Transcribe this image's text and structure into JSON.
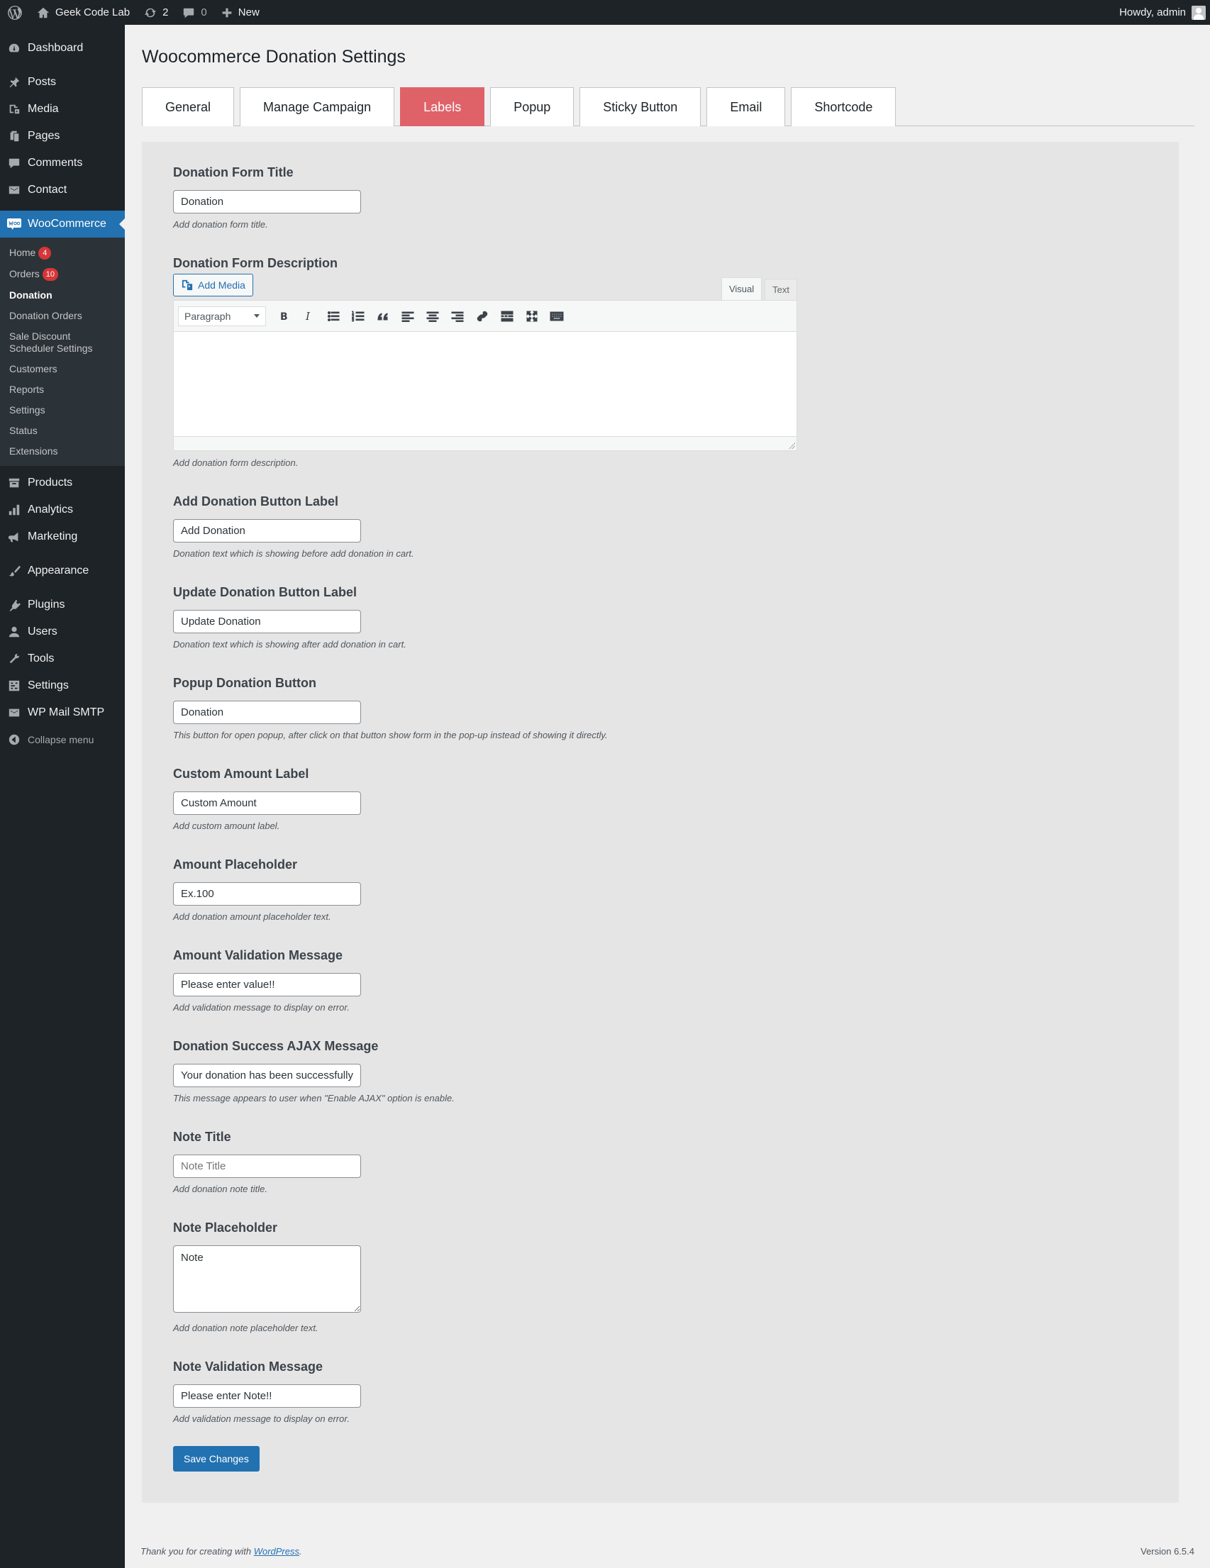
{
  "admin_bar": {
    "site_name": "Geek Code Lab",
    "updates_count": "2",
    "comments_count": "0",
    "new_label": "New",
    "howdy": "Howdy, admin"
  },
  "sidebar": {
    "top_items": [
      {
        "label": "Dashboard",
        "icon": "dashboard-icon"
      },
      {
        "label": "Posts",
        "icon": "pin-icon"
      },
      {
        "label": "Media",
        "icon": "media-icon"
      },
      {
        "label": "Pages",
        "icon": "pages-icon"
      },
      {
        "label": "Comments",
        "icon": "comment-icon"
      },
      {
        "label": "Contact",
        "icon": "mail-icon"
      }
    ],
    "woocommerce_label": "WooCommerce",
    "woo_submenu": [
      {
        "label": "Home",
        "badge": "4"
      },
      {
        "label": "Orders",
        "badge": "10"
      },
      {
        "label": "Donation"
      },
      {
        "label": "Donation Orders"
      },
      {
        "label": "Sale Discount Scheduler Settings"
      },
      {
        "label": "Customers"
      },
      {
        "label": "Reports"
      },
      {
        "label": "Settings"
      },
      {
        "label": "Status"
      },
      {
        "label": "Extensions"
      }
    ],
    "bottom_items": [
      {
        "label": "Products"
      },
      {
        "label": "Analytics"
      },
      {
        "label": "Marketing"
      },
      {
        "label": "Appearance"
      },
      {
        "label": "Plugins"
      },
      {
        "label": "Users"
      },
      {
        "label": "Tools"
      },
      {
        "label": "Settings"
      },
      {
        "label": "WP Mail SMTP"
      }
    ],
    "collapse_label": "Collapse menu"
  },
  "page": {
    "title": "Woocommerce Donation Settings",
    "tabs": [
      "General",
      "Manage Campaign",
      "Labels",
      "Popup",
      "Sticky Button",
      "Email",
      "Shortcode"
    ],
    "active_tab": "Labels"
  },
  "form": {
    "donation_form_title": {
      "label": "Donation Form Title",
      "value": "Donation",
      "help": "Add donation form title."
    },
    "donation_form_description": {
      "label": "Donation Form Description",
      "add_media": "Add Media",
      "tab_visual": "Visual",
      "tab_text": "Text",
      "format": "Paragraph",
      "help": "Add donation form description."
    },
    "add_donation_button": {
      "label": "Add Donation Button Label",
      "value": "Add Donation",
      "help": "Donation text which is showing before add donation in cart."
    },
    "update_donation_button": {
      "label": "Update Donation Button Label",
      "value": "Update Donation",
      "help": "Donation text which is showing after add donation in cart."
    },
    "popup_donation_button": {
      "label": "Popup Donation Button",
      "value": "Donation",
      "help": "This button for open popup, after click on that button show form in the pop-up instead of showing it directly."
    },
    "custom_amount_label": {
      "label": "Custom Amount Label",
      "value": "Custom Amount",
      "help": "Add custom amount label."
    },
    "amount_placeholder": {
      "label": "Amount Placeholder",
      "value": "Ex.100",
      "help": "Add donation amount placeholder text."
    },
    "amount_validation": {
      "label": "Amount Validation Message",
      "value": "Please enter value!!",
      "help": "Add validation message to display on error."
    },
    "success_ajax": {
      "label": "Donation Success AJAX Message",
      "value": "Your donation has been successfully",
      "help": "This message appears to user when \"Enable AJAX\" option is enable."
    },
    "note_title": {
      "label": "Note Title",
      "placeholder": "Note Title",
      "help": "Add donation note title."
    },
    "note_placeholder": {
      "label": "Note Placeholder",
      "value": "Note",
      "help": "Add donation note placeholder text."
    },
    "note_validation": {
      "label": "Note Validation Message",
      "value": "Please enter Note!!",
      "help": "Add validation message to display on error."
    },
    "save_label": "Save Changes"
  },
  "footer": {
    "thanks_prefix": "Thank you for creating with ",
    "wordpress_link": "WordPress",
    "thanks_suffix": ".",
    "version": "Version 6.5.4"
  },
  "colors": {
    "admin_dark": "#1d2327",
    "accent_blue": "#2271b1",
    "active_tab": "#e06269",
    "badge_red": "#d63638"
  }
}
